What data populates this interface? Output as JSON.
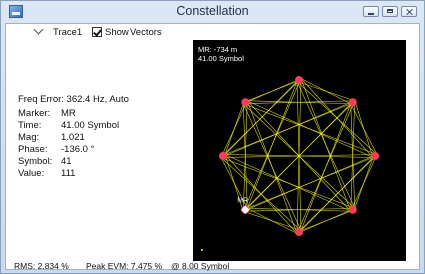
{
  "window": {
    "title": "Constellation"
  },
  "toolbar": {
    "trace_label": "Trace1",
    "show_label": "Show",
    "vectors_label": "Vectors",
    "show_checked": true
  },
  "info": {
    "freq_error": "Freq Error: 362.4 Hz, Auto",
    "rows": [
      {
        "label": "Marker:",
        "value": "MR"
      },
      {
        "label": "Time:",
        "value": "41.00 Symbol"
      },
      {
        "label": "Mag:",
        "value": "1.021"
      },
      {
        "label": "Phase:",
        "value": "-136.0 °"
      },
      {
        "label": "Symbol:",
        "value": "41"
      },
      {
        "label": "Value:",
        "value": "111"
      }
    ]
  },
  "plot": {
    "marker_readout_line1": "MR: -734 m",
    "marker_readout_line2": "41.00 Symbol",
    "marker_label": "MR",
    "background_color": "#000000",
    "trace_color": "#ffff00",
    "point_color": "#ff3b5c"
  },
  "status": {
    "rms": "RMS: 2.834 %",
    "peak_evm": "Peak EVM:  7.475 %",
    "at_symbol": "@  8.00 Symbol"
  }
}
